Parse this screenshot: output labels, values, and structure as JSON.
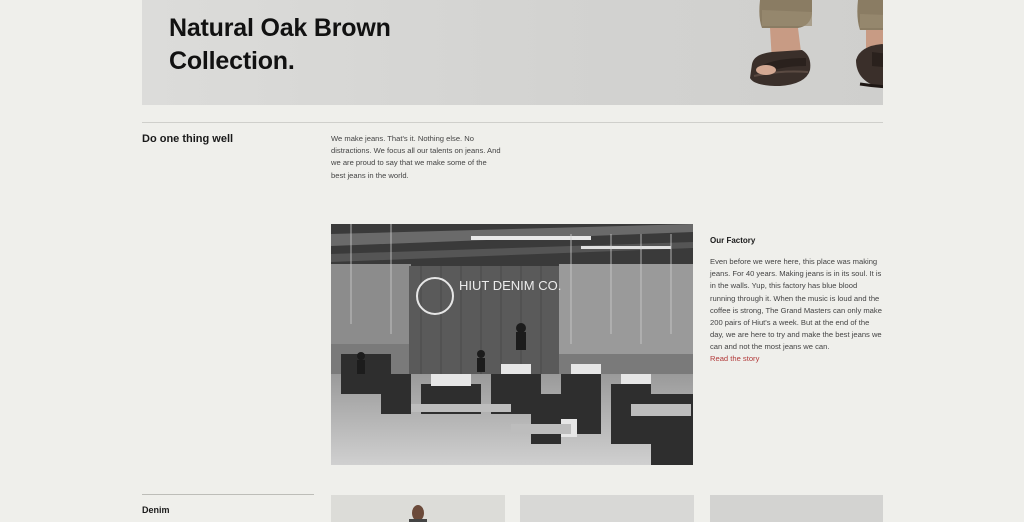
{
  "hero": {
    "title_line1": "Natural Oak Brown",
    "title_line2": "Collection."
  },
  "intro": {
    "heading": "Do one thing well",
    "body": "We make jeans. That's it. Nothing else. No distractions. We focus all our talents on jeans. And we are proud to say that we make some of the best jeans in the world."
  },
  "factory": {
    "heading": "Our Factory",
    "body": "Even before we were here, this place was making jeans. For 40 years. Making jeans is in its soul. It is in the walls. Yup, this factory has blue blood running through it. When the music is loud and the coffee is strong, The Grand Masters can only make 200 pairs of Hiut's a week. But at the end of the day, we are here to try and make the best jeans we can and not the most jeans we can.",
    "link_label": "Read the story",
    "sign_text": "HIUT DENIM CO."
  },
  "denim": {
    "heading": "Denim"
  },
  "colors": {
    "background": "#efefeb",
    "link": "#b23a3a"
  }
}
